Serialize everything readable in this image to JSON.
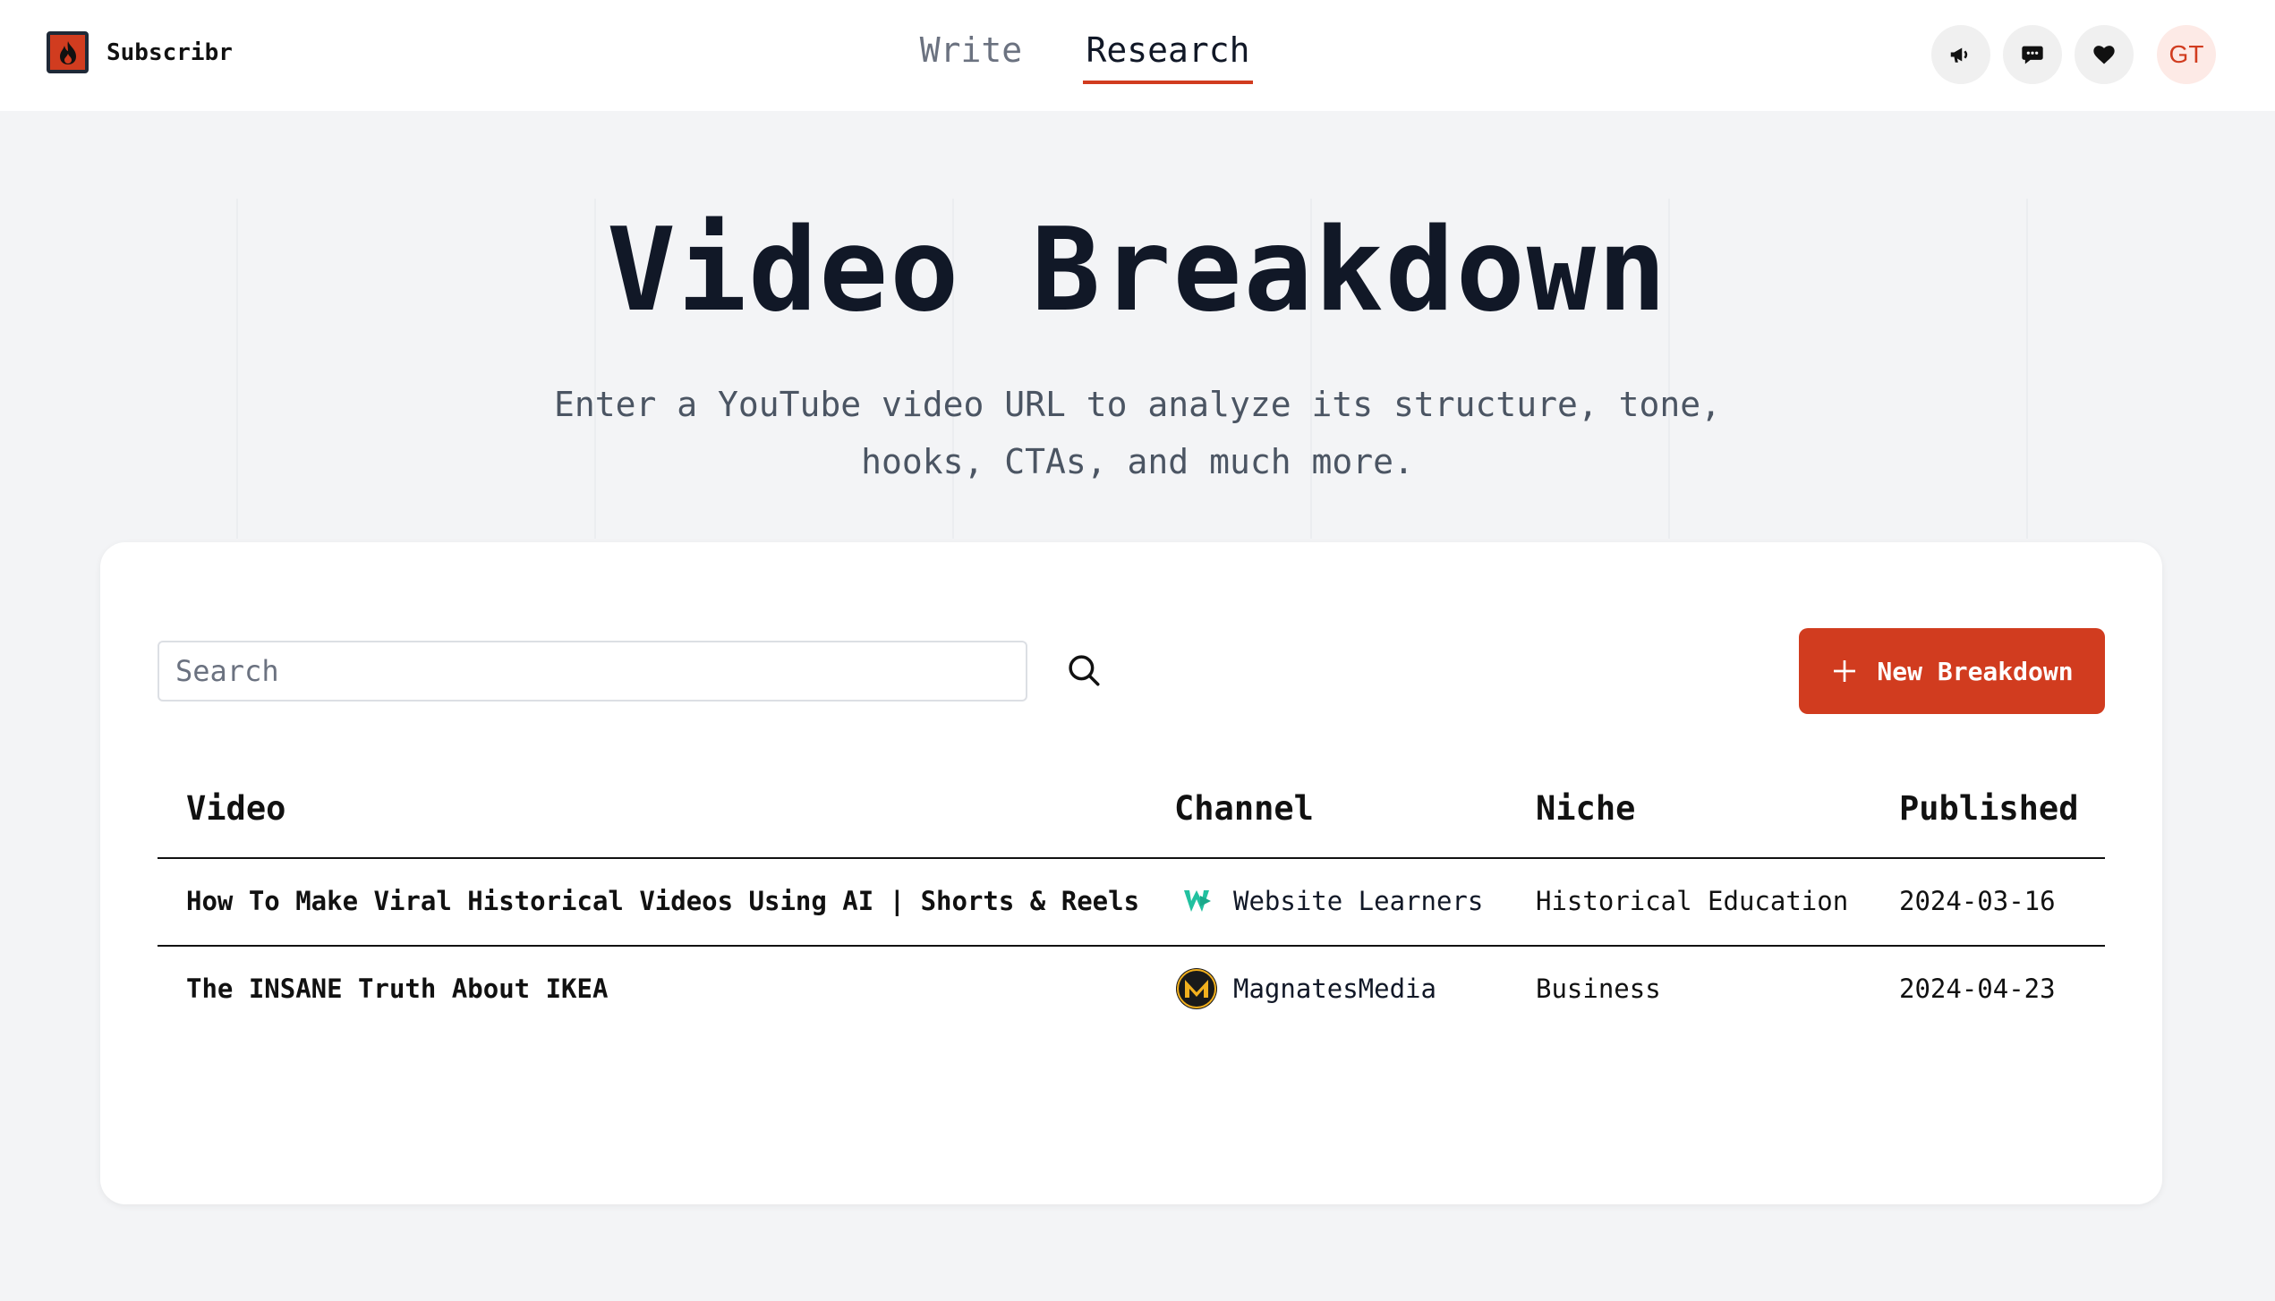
{
  "app": {
    "name": "Subscribr"
  },
  "nav": {
    "tabs": [
      {
        "label": "Write"
      },
      {
        "label": "Research",
        "active": true
      }
    ]
  },
  "header_actions": {
    "icons": [
      "megaphone-icon",
      "chat-icon",
      "heart-icon"
    ],
    "avatar_initials": "GT"
  },
  "hero": {
    "title": "Video Breakdown",
    "subtitle_line1": "Enter a YouTube video URL to analyze its structure, tone,",
    "subtitle_line2": "hooks, CTAs, and much more."
  },
  "search": {
    "placeholder": "Search",
    "value": ""
  },
  "new_button": {
    "label": "New Breakdown"
  },
  "table": {
    "columns": [
      "Video",
      "Channel",
      "Niche",
      "Published"
    ],
    "rows": [
      {
        "video": "How To Make Viral Historical Videos Using AI | Shorts & Reels",
        "channel": "Website Learners",
        "channel_icon": "website-learners-logo",
        "niche": "Historical Education",
        "published": "2024-03-16"
      },
      {
        "video": "The INSANE Truth About IKEA",
        "channel": "MagnatesMedia",
        "channel_icon": "magnatesmedia-logo",
        "niche": "Business",
        "published": "2024-04-23"
      }
    ]
  },
  "colors": {
    "accent": "#d13c1f",
    "background": "#f3f4f6",
    "text": "#111827",
    "muted": "#6b7280"
  }
}
